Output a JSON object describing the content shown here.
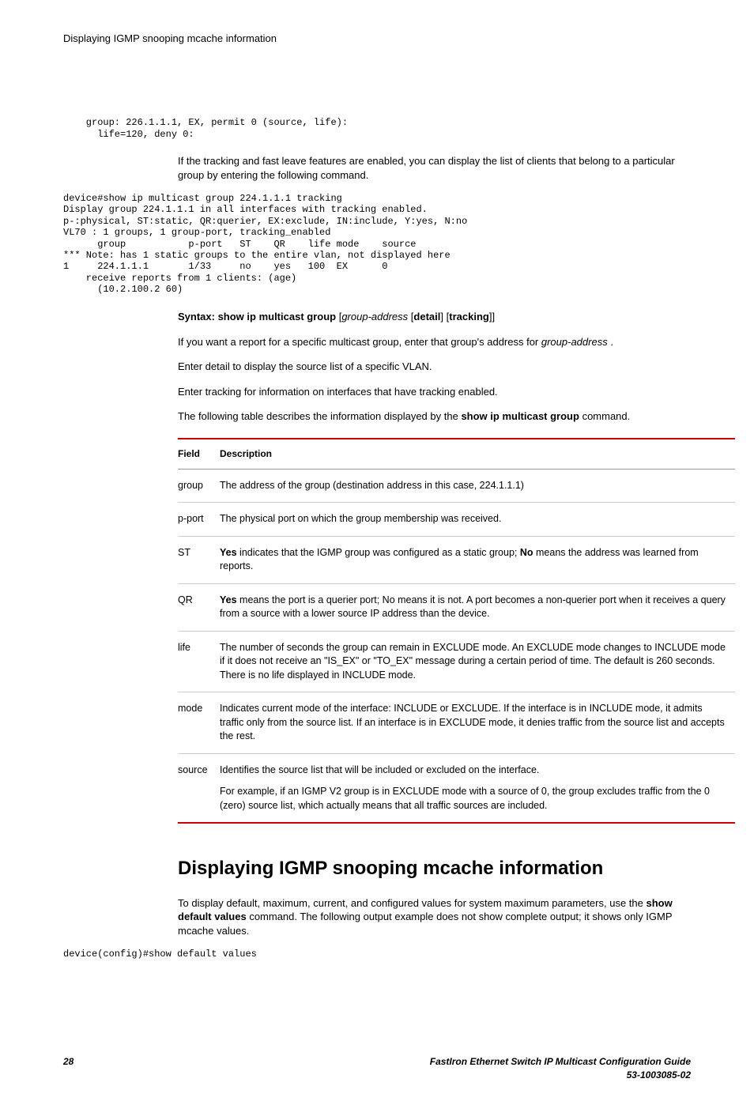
{
  "header": {
    "title": "Displaying IGMP snooping mcache information"
  },
  "code1": "    group: 226.1.1.1, EX, permit 0 (source, life):\n      life=120, deny 0:",
  "para1": "If the tracking and fast leave features are enabled, you can display the list of clients that belong to a particular group by entering the following command.",
  "code2": "device#show ip multicast group 224.1.1.1 tracking\nDisplay group 224.1.1.1 in all interfaces with tracking enabled.\np-:physical, ST:static, QR:querier, EX:exclude, IN:include, Y:yes, N:no\nVL70 : 1 groups, 1 group-port, tracking_enabled\n      group           p-port   ST    QR    life mode    source\n*** Note: has 1 static groups to the entire vlan, not displayed here\n1     224.1.1.1       1/33     no    yes   100  EX      0\n    receive reports from 1 clients: (age)\n      (10.2.100.2 60)",
  "syntax": {
    "prefix": "Syntax: show ip multicast group",
    "arg1": "group-address",
    "lb": "[",
    "rb": "]",
    "detail": "detail",
    "tracking": "tracking",
    "close": "]]"
  },
  "para2_a": "If you want a report for a specific multicast group, enter that group's address for ",
  "para2_b": "group-address",
  "para2_c": " .",
  "para3": "Enter detail to display the source list of a specific VLAN.",
  "para4": "Enter tracking for information on interfaces that have tracking enabled.",
  "para5_a": "The following table describes the information displayed by the ",
  "para5_b": "show ip multicast group",
  "para5_c": " command.",
  "table": {
    "headField": "Field",
    "headDesc": "Description",
    "rows": [
      {
        "field": "group",
        "desc": "The address of the group (destination address in this case, 224.1.1.1)"
      },
      {
        "field": "p-port",
        "desc": "The physical port on which the group membership was received."
      },
      {
        "field": "ST",
        "desc_a": "Yes",
        "desc_b": " indicates that the IGMP group was configured as a static group; ",
        "desc_c": "No",
        "desc_d": " means the address was learned from reports."
      },
      {
        "field": "QR",
        "desc_a": "Yes",
        "desc_b": " means the port is a querier port; No means it is not. A port becomes a non-querier port when it receives a query from a source with a lower source IP address than the device."
      },
      {
        "field": "life",
        "desc": "The number of seconds the group can remain in EXCLUDE mode. An EXCLUDE mode changes to INCLUDE mode if it does not receive an \"IS_EX\" or \"TO_EX\" message during a certain period of time. The default is 260 seconds. There is no life displayed in INCLUDE mode."
      },
      {
        "field": "mode",
        "desc": "Indicates current mode of the interface: INCLUDE or EXCLUDE. If the interface is in INCLUDE mode, it admits traffic only from the source list. If an interface is in EXCLUDE mode, it denies traffic from the source list and accepts the rest."
      },
      {
        "field": "source",
        "desc1": "Identifies the source list that will be included or excluded on the interface.",
        "desc2": "For example, if an IGMP V2 group is in EXCLUDE mode with a source of 0, the group excludes traffic from the 0 (zero) source list, which actually means that all traffic sources are included."
      }
    ]
  },
  "section_heading": "Displaying IGMP snooping mcache information",
  "para6_a": "To display default, maximum, current, and configured values for system maximum parameters, use the ",
  "para6_b": "show default values",
  "para6_c": " command. The following output example does not show complete output; it shows only IGMP mcache values.",
  "code3": "device(config)#show default values",
  "footer": {
    "page": "28",
    "guide": "FastIron Ethernet Switch IP Multicast Configuration Guide",
    "docnum": "53-1003085-02"
  }
}
